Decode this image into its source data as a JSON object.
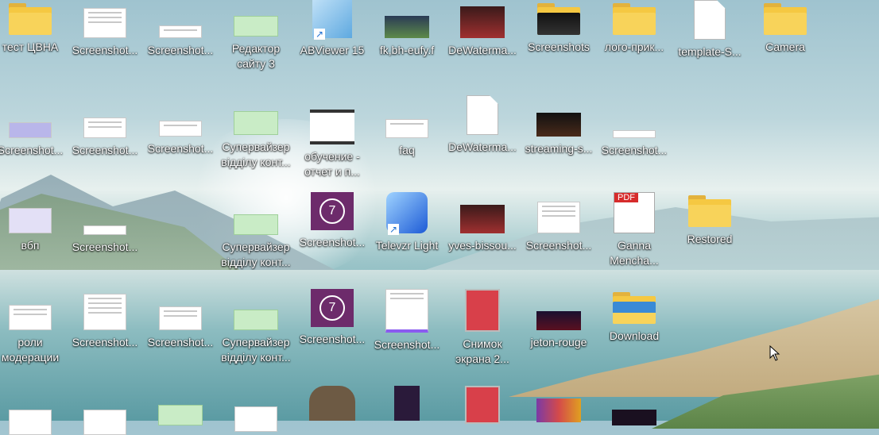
{
  "desktop": {
    "row1": [
      {
        "label": "тест ЦВНА",
        "icon": "excel-folder-icon"
      },
      {
        "label": "Screenshot...",
        "icon": "screenshot-icon"
      },
      {
        "label": "Screenshot...",
        "icon": "screenshot-icon"
      },
      {
        "label": "Редактор сайту 3",
        "icon": "green-doc-icon"
      },
      {
        "label": "ABViewer 15",
        "icon": "abviewer-icon"
      },
      {
        "label": "fk,bh-eufy.f",
        "icon": "photo-icon"
      },
      {
        "label": "DeWaterma...",
        "icon": "photo-icon"
      },
      {
        "label": "Screenshots",
        "icon": "folder-icon"
      },
      {
        "label": "лого-прик...",
        "icon": "zip-folder-icon"
      },
      {
        "label": "template-S...",
        "icon": "blank-file-icon"
      },
      {
        "label": "Camera",
        "icon": "folder-icon"
      }
    ],
    "row2": [
      {
        "label": "Screenshot...",
        "icon": "screenshot-icon"
      },
      {
        "label": "Screenshot...",
        "icon": "screenshot-icon"
      },
      {
        "label": "Screenshot...",
        "icon": "screenshot-icon"
      },
      {
        "label": "Супервайзер відділу конт...",
        "icon": "green-doc-icon"
      },
      {
        "label": "обучение - отчет и п...",
        "icon": "video-icon"
      },
      {
        "label": "faq",
        "icon": "doc-icon"
      },
      {
        "label": "DeWaterma...",
        "icon": "blank-file-icon"
      },
      {
        "label": "streaming-s...",
        "icon": "photo-icon"
      },
      {
        "label": "Screenshot...",
        "icon": "screenshot-icon"
      }
    ],
    "row3": [
      {
        "label": "вбп",
        "icon": "screenshot-icon"
      },
      {
        "label": "Screenshot...",
        "icon": "screenshot-icon"
      },
      {
        "label": "Супервайзер відділу конт...",
        "icon": "green-doc-icon"
      },
      {
        "label": "Screenshot...",
        "icon": "purple-logo-icon"
      },
      {
        "label": "Televzr Light",
        "icon": "televzr-icon"
      },
      {
        "label": "yves-bissou...",
        "icon": "photo-icon"
      },
      {
        "label": "Screenshot...",
        "icon": "screenshot-icon"
      },
      {
        "label": "Ganna Mencha...",
        "icon": "pdf-icon"
      },
      {
        "label": "Restored",
        "icon": "folder-icon"
      }
    ],
    "row4": [
      {
        "label": "роли модерации",
        "icon": "doc-icon"
      },
      {
        "label": "Screenshot...",
        "icon": "screenshot-icon"
      },
      {
        "label": "Screenshot...",
        "icon": "screenshot-icon"
      },
      {
        "label": "Супервайзер відділу конт...",
        "icon": "green-doc-icon"
      },
      {
        "label": "Screenshot...",
        "icon": "purple-logo-icon"
      },
      {
        "label": "Screenshot...",
        "icon": "screenshot-icon"
      },
      {
        "label": "Снимок экрана 2...",
        "icon": "screenshot-icon"
      },
      {
        "label": "jeton-rouge",
        "icon": "photo-icon"
      },
      {
        "label": "Download",
        "icon": "folder-icon"
      }
    ]
  }
}
